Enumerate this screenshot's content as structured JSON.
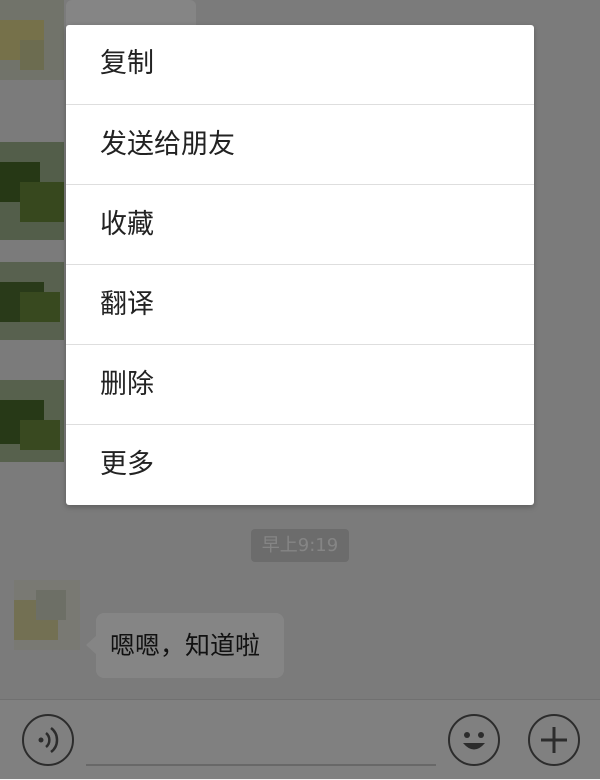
{
  "context_menu": {
    "items": [
      {
        "label": "复制"
      },
      {
        "label": "发送给朋友"
      },
      {
        "label": "收藏"
      },
      {
        "label": "翻译"
      },
      {
        "label": "删除"
      },
      {
        "label": "更多"
      }
    ]
  },
  "chat": {
    "timestamp": "早上9:19",
    "last_message": {
      "text": "嗯嗯，知道啦"
    }
  },
  "toolbar": {
    "voice_icon": "voice-icon",
    "emoji_icon": "emoji-icon",
    "plus_icon": "plus-icon"
  },
  "colors": {
    "chat_background": "#ebebeb",
    "bubble": "#ffffff",
    "menu_background": "#ffffff",
    "overlay": "rgba(0,0,0,0.48)"
  }
}
